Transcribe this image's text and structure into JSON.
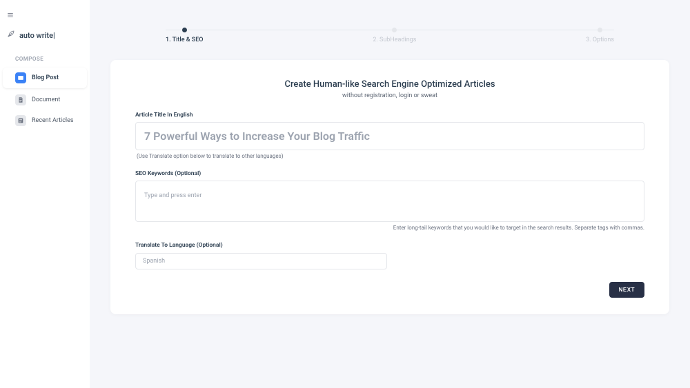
{
  "brand": {
    "name": "auto write|"
  },
  "sidebar": {
    "section": "COMPOSE",
    "items": [
      {
        "label": "Blog Post",
        "icon": "window-icon",
        "active": true
      },
      {
        "label": "Document",
        "icon": "document-icon",
        "active": false
      },
      {
        "label": "Recent Articles",
        "icon": "recent-icon",
        "active": false
      }
    ]
  },
  "steps": [
    {
      "label": "1. Title & SEO",
      "active": true
    },
    {
      "label": "2. SubHeadings",
      "active": false
    },
    {
      "label": "3. Options",
      "active": false
    }
  ],
  "card": {
    "title": "Create Human-like Search Engine Optimized Articles",
    "subtitle": "without registration, login or sweat"
  },
  "form": {
    "title_label": "Article Title In English",
    "title_placeholder": "7 Powerful Ways to Increase Your Blog Traffic",
    "title_hint": "(Use Translate option below to translate to other languages)",
    "seo_label": "SEO Keywords (Optional)",
    "seo_placeholder": "Type and press enter",
    "seo_hint": "Enter long-tail keywords that you would like to target in the search results. Separate tags with commas.",
    "translate_label": "Translate To Language (Optional)",
    "translate_placeholder": "Spanish"
  },
  "buttons": {
    "next": "NEXT"
  }
}
